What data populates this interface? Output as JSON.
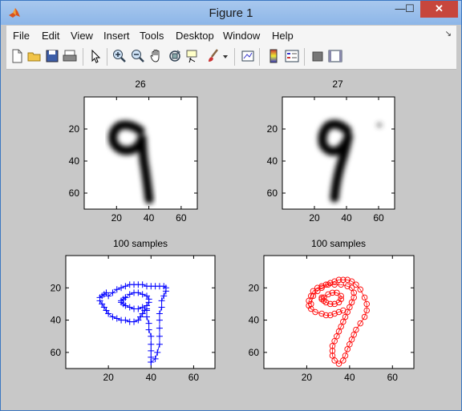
{
  "window": {
    "title": "Figure 1",
    "minimize": "—",
    "maximize": "☐",
    "close": "✕"
  },
  "menu": [
    "File",
    "Edit",
    "View",
    "Insert",
    "Tools",
    "Desktop",
    "Window",
    "Help"
  ],
  "menu_dock_glyph": "↘",
  "toolbar": {
    "icons": [
      "new-figure",
      "open-file",
      "save",
      "print",
      "edit-plot-arrow",
      "zoom-in",
      "zoom-out",
      "pan-hand",
      "rotate-3d",
      "data-cursor",
      "brush",
      "link-plot",
      "colorbar",
      "legend",
      "hide-plot-tools",
      "show-plot-tools"
    ]
  },
  "colors": {
    "blue_series": "#0000ff",
    "red_series": "#ff0000",
    "figure_bg": "#c8c8c8"
  },
  "chart_data": [
    {
      "type": "heatmap",
      "title": "26",
      "xticks": [
        20,
        40,
        60
      ],
      "yticks": [
        20,
        40,
        60
      ],
      "xlim": [
        0,
        70
      ],
      "ylim": [
        70,
        0
      ]
    },
    {
      "type": "heatmap",
      "title": "27",
      "xticks": [
        20,
        40,
        60
      ],
      "yticks": [
        20,
        40,
        60
      ],
      "xlim": [
        0,
        70
      ],
      "ylim": [
        70,
        0
      ]
    },
    {
      "type": "scatter",
      "title": "100 samples",
      "marker": "+",
      "color": "#0000ff",
      "xticks": [
        20,
        40,
        60
      ],
      "yticks": [
        20,
        40,
        60
      ],
      "xlim": [
        0,
        70
      ],
      "ylim": [
        70,
        0
      ],
      "series": [
        {
          "x": [
            20,
            22,
            24,
            26,
            28,
            30,
            32,
            34,
            36,
            38,
            40,
            42,
            44,
            46,
            47,
            47,
            46,
            45,
            45,
            44,
            44,
            44,
            44,
            44,
            43,
            42,
            40,
            40,
            40,
            40,
            40,
            40,
            39,
            39,
            38,
            38,
            38,
            37,
            36,
            35,
            34,
            32,
            30,
            28,
            26,
            24,
            22,
            20,
            19,
            18,
            17,
            16,
            16,
            17,
            18,
            19
          ],
          "y": [
            25,
            23,
            21,
            20,
            19,
            18,
            18,
            18,
            18,
            19,
            19,
            19,
            19,
            19,
            20,
            22,
            25,
            28,
            32,
            36,
            40,
            45,
            50,
            55,
            60,
            64,
            66,
            66,
            63,
            59,
            55,
            50,
            46,
            42,
            38,
            34,
            33,
            34,
            36,
            38,
            40,
            41,
            41,
            40,
            40,
            39,
            38,
            36,
            34,
            32,
            30,
            28,
            26,
            25,
            24,
            23
          ]
        },
        {
          "x": [
            28,
            30,
            32,
            34,
            36,
            38,
            39,
            39,
            38,
            36,
            34,
            32,
            30,
            28,
            27,
            26,
            26,
            27,
            28
          ],
          "y": [
            26,
            24,
            23,
            23,
            24,
            25,
            27,
            29,
            31,
            32,
            33,
            33,
            32,
            31,
            30,
            29,
            28,
            27,
            26
          ]
        }
      ]
    },
    {
      "type": "scatter",
      "title": "100 samples",
      "marker": "o",
      "color": "#ff0000",
      "xticks": [
        20,
        40,
        60
      ],
      "yticks": [
        20,
        40,
        60
      ],
      "xlim": [
        0,
        70
      ],
      "ylim": [
        70,
        0
      ],
      "series": [
        {
          "x": [
            22,
            23,
            25,
            27,
            30,
            33,
            36,
            39,
            41,
            42,
            42,
            41,
            40,
            39,
            38,
            37,
            36,
            35,
            34,
            33,
            32,
            32,
            32,
            33,
            35,
            37,
            38,
            39,
            40,
            41,
            42,
            43,
            45,
            47,
            48,
            48,
            47,
            45,
            43,
            41,
            39,
            37,
            35,
            33,
            31,
            29,
            27,
            25,
            23,
            22,
            21,
            21,
            22,
            24,
            27,
            29,
            31,
            33,
            35,
            37
          ],
          "y": [
            30,
            25,
            22,
            20,
            18,
            18,
            18,
            19,
            20,
            23,
            26,
            29,
            32,
            35,
            38,
            41,
            44,
            47,
            50,
            53,
            56,
            59,
            62,
            65,
            67,
            65,
            62,
            58,
            55,
            52,
            49,
            46,
            42,
            38,
            34,
            30,
            26,
            21,
            18,
            16,
            15,
            15,
            15,
            16,
            17,
            18,
            19,
            20,
            22,
            25,
            28,
            31,
            33,
            35,
            36,
            37,
            37,
            36,
            35,
            34
          ]
        },
        {
          "x": [
            28,
            30,
            32,
            34,
            36,
            36,
            35,
            33,
            31,
            29,
            28,
            27,
            27
          ],
          "y": [
            26,
            24,
            23,
            23,
            25,
            27,
            29,
            30,
            30,
            29,
            28,
            27,
            26
          ]
        }
      ]
    }
  ]
}
